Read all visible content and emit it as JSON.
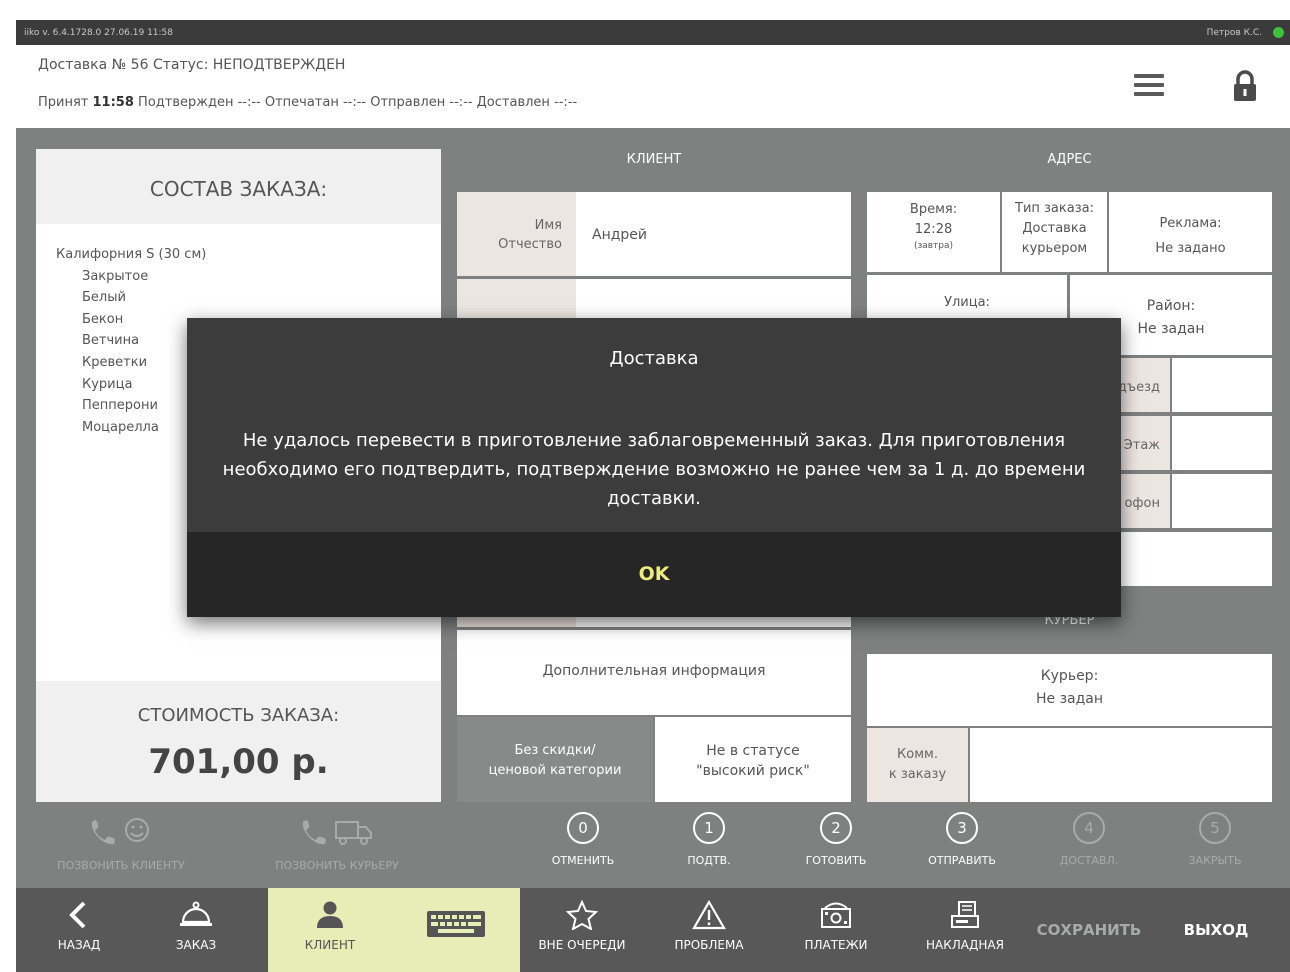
{
  "titlebar": {
    "version": "iiko v. 6.4.1728.0   27.06.19  11:58",
    "user": "Петров К.С."
  },
  "header": {
    "order_line": "Доставка № 56  Статус: НЕПОДТВЕРЖДЕН",
    "accepted_label": "Принят",
    "accepted_time": "11:58",
    "status_times": "Подтвержден --:--  Отпечатан --:--  Отправлен --:--  Доставлен --:--"
  },
  "order": {
    "title": "СОСТАВ ЗАКАЗА:",
    "product": "Калифорния S (30 см)",
    "modifiers": [
      "Закрытое",
      "Белый",
      "Бекон",
      "Ветчина",
      "Креветки",
      "Курица",
      "Пепперони",
      "Моцарелла"
    ],
    "cost_label": "СТОИМОСТЬ ЗАКАЗА:",
    "cost_value": "701,00 р."
  },
  "client": {
    "header": "КЛИЕНТ",
    "name_label": "Имя\nОтчество",
    "name_value": "Андрей",
    "extra_info": "Дополнительная информация",
    "no_discount": "Без скидки/\nценовой категории",
    "risk": "Не в статусе\n\"высокий риск\""
  },
  "address": {
    "header": "АДРЕС",
    "time_label": "Время:",
    "time_value": "12:28",
    "time_note": "(завтра)",
    "order_type_label": "Тип заказа:",
    "order_type_value": "Доставка\nкурьером",
    "ads_label": "Реклама:",
    "ads_value": "Не задано",
    "street_label": "Улица:",
    "district_label": "Район:",
    "district_value": "Не задан",
    "entrance_label": "дъезд",
    "floor_label": "Этаж",
    "phone_label": "офон"
  },
  "courier": {
    "header": "КУРЬЕР",
    "label": "Курьер:",
    "value": "Не задан",
    "comment_label": "Комм.\nк заказу"
  },
  "status_actions": [
    {
      "num": "0",
      "label": "ОТМЕНИТЬ",
      "enabled": true
    },
    {
      "num": "1",
      "label": "ПОДТВ.",
      "enabled": true
    },
    {
      "num": "2",
      "label": "ГОТОВИТЬ",
      "enabled": true
    },
    {
      "num": "3",
      "label": "ОТПРАВИТЬ",
      "enabled": true
    },
    {
      "num": "4",
      "label": "ДОСТАВЛ.",
      "enabled": false
    },
    {
      "num": "5",
      "label": "ЗАКРЫТЬ",
      "enabled": false
    }
  ],
  "calls": {
    "client": "ПОЗВОНИТЬ КЛИЕНТУ",
    "courier": "ПОЗВОНИТЬ КУРЬЕРУ"
  },
  "bottom": {
    "back": "НАЗАД",
    "order": "ЗАКАЗ",
    "client": "КЛИЕНТ",
    "out_of_queue": "ВНЕ ОЧЕРЕДИ",
    "problem": "ПРОБЛЕМА",
    "payments": "ПЛАТЕЖИ",
    "invoice": "НАКЛАДНАЯ",
    "save": "СОХРАНИТЬ",
    "exit": "ВЫХОД"
  },
  "dialog": {
    "title": "Доставка",
    "message": "Не удалось перевести в приготовление заблаговременный заказ. Для приготовления необходимо его подтвердить, подтверждение возможно не ранее чем за 1 д. до времени доставки.",
    "ok": "OK"
  },
  "colors": {
    "accent_tab": "#e8ecb6",
    "ok_text": "#ecec7c",
    "online_dot": "#3ec23e"
  }
}
